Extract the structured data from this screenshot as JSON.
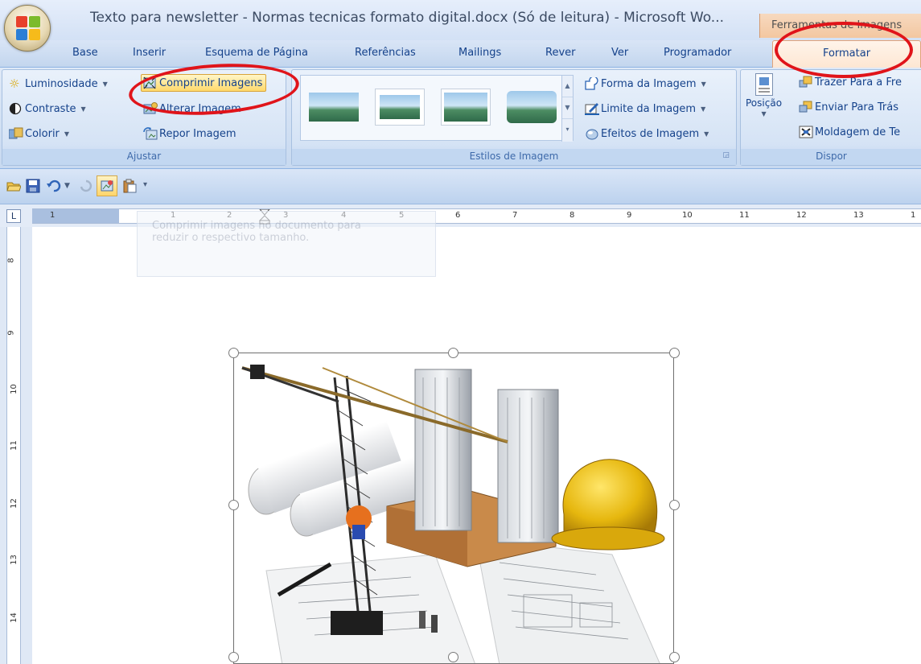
{
  "window": {
    "title": "Texto para newsletter - Normas tecnicas formato digital.docx (Só de leitura) - Microsoft Wo...",
    "context_tab_header": "Ferramentas de Imagens"
  },
  "tabs": [
    "Base",
    "Inserir",
    "Esquema de Página",
    "Referências",
    "Mailings",
    "Rever",
    "Ver",
    "Programador"
  ],
  "active_tab": "Formatar",
  "ribbon": {
    "ajustar": {
      "label": "Ajustar",
      "luminosidade": "Luminosidade",
      "contraste": "Contraste",
      "colorir": "Colorir",
      "comprimir": "Comprimir Imagens",
      "alterar": "Alterar Imagem",
      "repor": "Repor Imagem"
    },
    "estilos": {
      "label": "Estilos de Imagem",
      "forma": "Forma da Imagem",
      "limite": "Limite da Imagem",
      "efeitos": "Efeitos de Imagem"
    },
    "dispor": {
      "label": "Dispor",
      "posicao": "Posição",
      "trazer": "Trazer Para a Fre",
      "enviar": "Enviar Para Trás",
      "moldagem": "Moldagem de Te"
    }
  },
  "ruler": {
    "corner": "L",
    "h_numbers": [
      "1",
      "1",
      "2",
      "3",
      "4",
      "5",
      "6",
      "7",
      "8",
      "9",
      "10",
      "11",
      "12",
      "13",
      "1"
    ],
    "v_numbers": [
      "8",
      "9",
      "10",
      "11",
      "12",
      "13",
      "14"
    ]
  },
  "tooltip_ghost": {
    "line1": "Comprimir imagens no documento para",
    "line2": "reduzir o respectivo tamanho."
  },
  "colors": {
    "annotation_red": "#e0141a",
    "ribbon_blue": "#15428b",
    "context_orange": "#f3c7a0"
  }
}
